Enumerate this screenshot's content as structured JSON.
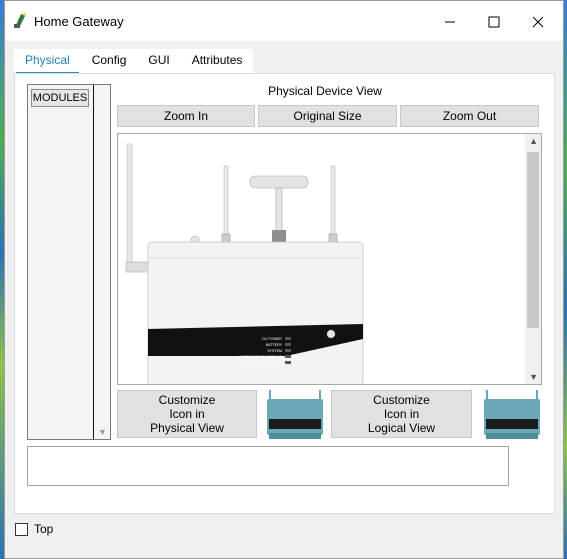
{
  "window": {
    "title": "Home Gateway"
  },
  "tabs": [
    {
      "label": "Physical",
      "active": true
    },
    {
      "label": "Config",
      "active": false
    },
    {
      "label": "GUI",
      "active": false
    },
    {
      "label": "Attributes",
      "active": false
    }
  ],
  "modules": {
    "label": "MODULES"
  },
  "physical_view": {
    "title": "Physical Device View",
    "zoom_in": "Zoom In",
    "original_size": "Original Size",
    "zoom_out": "Zoom Out"
  },
  "device_leds": [
    "DC POWER",
    "BATTERY",
    "SYSTEM",
    "WIRELESS BROADBAND",
    "WIRELESS BROADBAND"
  ],
  "customize": {
    "physical": [
      "Customize",
      "Icon in",
      "Physical View"
    ],
    "logical": [
      "Customize",
      "Icon in",
      "Logical View"
    ]
  },
  "footer": {
    "top_label": "Top",
    "top_checked": false
  },
  "icons": {
    "app": "gateway-icon",
    "minimize": "minimize-icon",
    "maximize": "maximize-icon",
    "close": "close-icon"
  },
  "colors": {
    "accent": "#1f8fd0",
    "device_icon": "#6aa8b8"
  }
}
